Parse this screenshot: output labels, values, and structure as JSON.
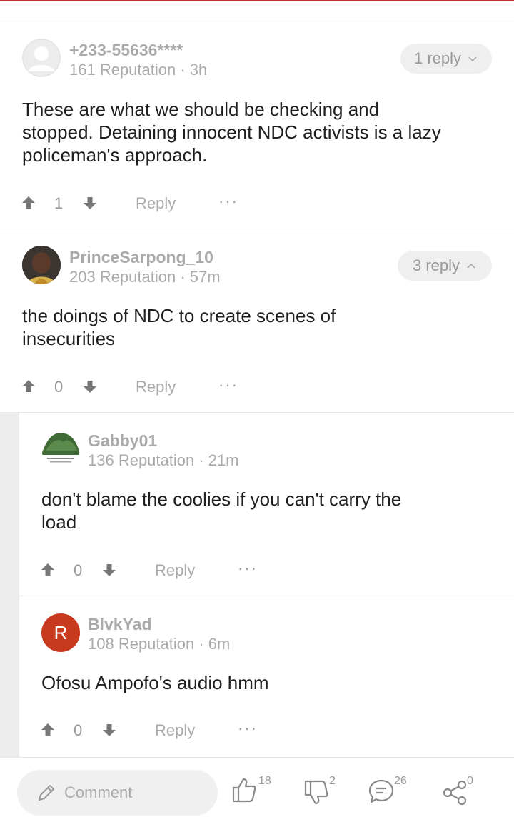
{
  "comments": [
    {
      "user": "+233-55636****",
      "reputation": "161 Reputation",
      "time": "3h",
      "reply_pill": "1 reply",
      "text": "These are what we should be checking and stopped. Detaining innocent NDC activists is a lazy policeman's approach.",
      "votes": "1",
      "reply_label": "Reply",
      "more": "···"
    },
    {
      "user": "PrinceSarpong_10",
      "reputation": "203 Reputation",
      "time": "57m",
      "reply_pill": "3 reply",
      "text": "the doings of NDC to create scenes of insecurities",
      "votes": "0",
      "reply_label": "Reply",
      "more": "···"
    }
  ],
  "replies": [
    {
      "user": "Gabby01",
      "reputation": "136 Reputation",
      "time": "21m",
      "text": "don't blame the coolies if you can't carry the load",
      "votes": "0",
      "reply_label": "Reply",
      "more": "···"
    },
    {
      "user": "BlvkYad",
      "avatar_letter": "R",
      "reputation": "108 Reputation",
      "time": "6m",
      "text": "Ofosu Ampofo's audio hmm",
      "votes": "0",
      "reply_label": "Reply",
      "more": "···"
    }
  ],
  "bottom_bar": {
    "comment_placeholder": "Comment",
    "likes": "18",
    "dislikes": "2",
    "comments": "26",
    "shares": "0"
  },
  "colors": {
    "accent": "#c0303a",
    "avatar_letter_bg": "#c83a1e",
    "muted": "#aaaaaa"
  },
  "icons": [
    "user-placeholder-icon",
    "chevron-down-icon",
    "chevron-up-icon",
    "upvote-icon",
    "downvote-icon",
    "pencil-icon",
    "thumbs-up-icon",
    "thumbs-down-icon",
    "comment-bubble-icon",
    "share-icon"
  ]
}
